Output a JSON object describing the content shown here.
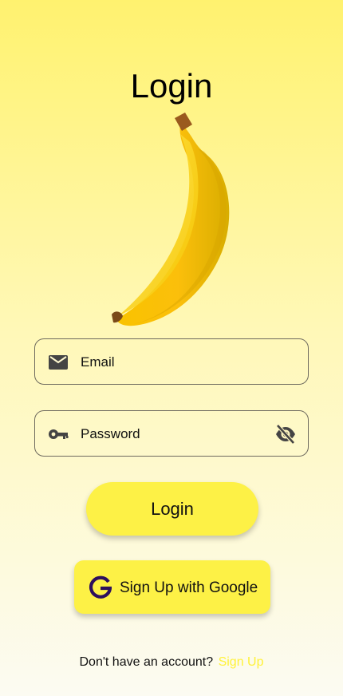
{
  "page": {
    "title": "Login"
  },
  "form": {
    "email_placeholder": "Email",
    "password_placeholder": "Password"
  },
  "buttons": {
    "login_label": "Login",
    "google_label": "Sign Up with Google"
  },
  "footer": {
    "prompt": "Don't have an account?",
    "signup_link": "Sign Up"
  },
  "icons": {
    "email": "mail-icon",
    "password": "key-icon",
    "visibility": "eye-off-icon",
    "google": "google-icon",
    "illustration": "banana-illustration"
  },
  "colors": {
    "accent_yellow": "#fdf146",
    "signup_link": "#fff23a",
    "google_g": "#2d0f5c",
    "background_top": "#fff26f",
    "background_bottom": "#fcfbf2"
  }
}
